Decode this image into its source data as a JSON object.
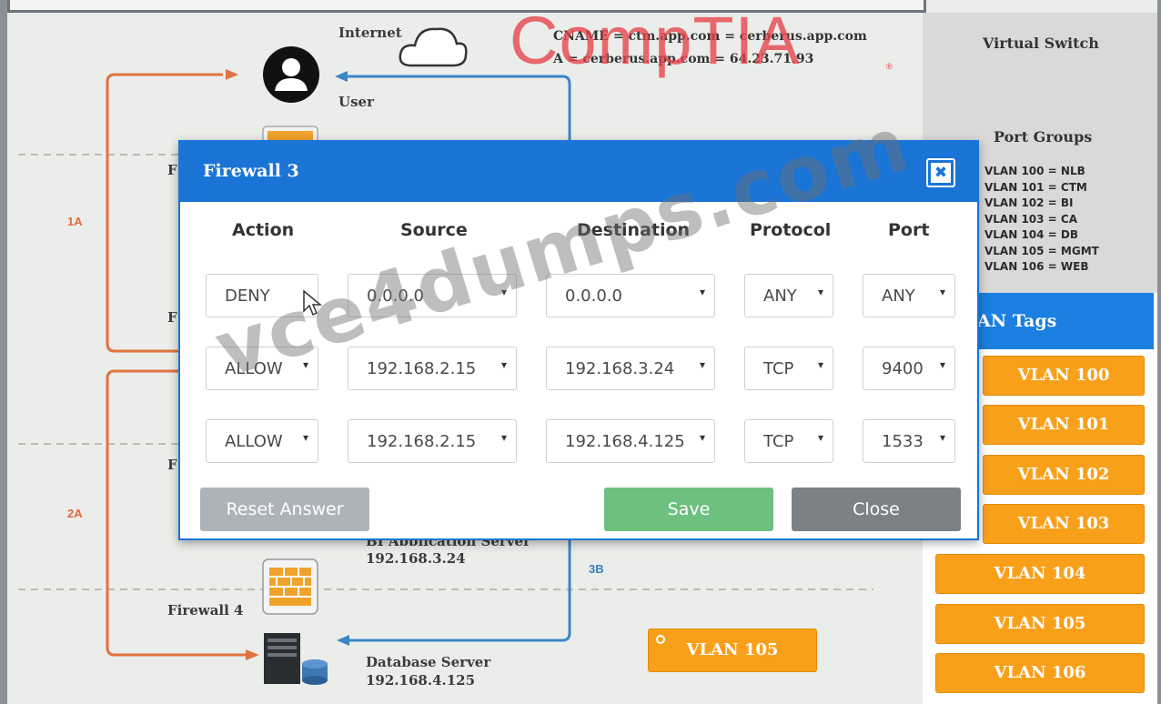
{
  "diagram": {
    "internet_label": "Internet",
    "user_label": "User",
    "dns_lines": [
      "CNAME = ctm.app.com = cerberus.app.com",
      "A = cerberus.app.com = 64.23.71.93"
    ],
    "flow_labels": {
      "f1a": "1A",
      "f2a": "2A",
      "f3b": "3B"
    },
    "partial_firewall_letters": [
      "F",
      "F",
      "F"
    ],
    "firewall4_label": "Firewall 4",
    "bi_server": {
      "name": "BI Application Server",
      "ip": "192.168.3.24"
    },
    "db_server": {
      "name": "Database Server",
      "ip": "192.168.4.125"
    },
    "placed_tag": "VLAN 105",
    "arrow_orange": "#e0733f",
    "arrow_blue": "#3a86c8"
  },
  "brand": {
    "logo_text": "CompTIA",
    "registered": "®",
    "color": "#e54149"
  },
  "virtual_switch": {
    "title": "Virtual Switch",
    "port_groups_title": "Port Groups",
    "port_groups": [
      "VLAN 100 = NLB",
      "VLAN 101 = CTM",
      "VLAN 102 = BI",
      "VLAN 103 = CA",
      "VLAN 104 = DB",
      "VLAN 105 = MGMT",
      "VLAN 106 = WEB"
    ]
  },
  "vlan_tags": {
    "header": "AN Tags",
    "tags": [
      "VLAN 100",
      "VLAN 101",
      "VLAN 102",
      "VLAN 103",
      "VLAN 104",
      "VLAN 105",
      "VLAN 106"
    ],
    "color": "#f9a01b",
    "header_color": "#1a7fe0"
  },
  "dialog": {
    "title": "Firewall 3",
    "close_glyph": "✖",
    "columns": [
      "Action",
      "Source",
      "Destination",
      "Protocol",
      "Port"
    ],
    "rows": [
      {
        "action": "DENY",
        "source": "0.0.0.0",
        "destination": "0.0.0.0",
        "protocol": "ANY",
        "port": "ANY"
      },
      {
        "action": "ALLOW",
        "source": "192.168.2.15",
        "destination": "192.168.3.24",
        "protocol": "TCP",
        "port": "9400"
      },
      {
        "action": "ALLOW",
        "source": "192.168.2.15",
        "destination": "192.168.4.125",
        "protocol": "TCP",
        "port": "1533"
      }
    ],
    "caret": "▾",
    "buttons": {
      "reset": "Reset Answer",
      "save": "Save",
      "close": "Close"
    },
    "header_color": "#1a74d6"
  },
  "watermark": "vce4dumps.com"
}
